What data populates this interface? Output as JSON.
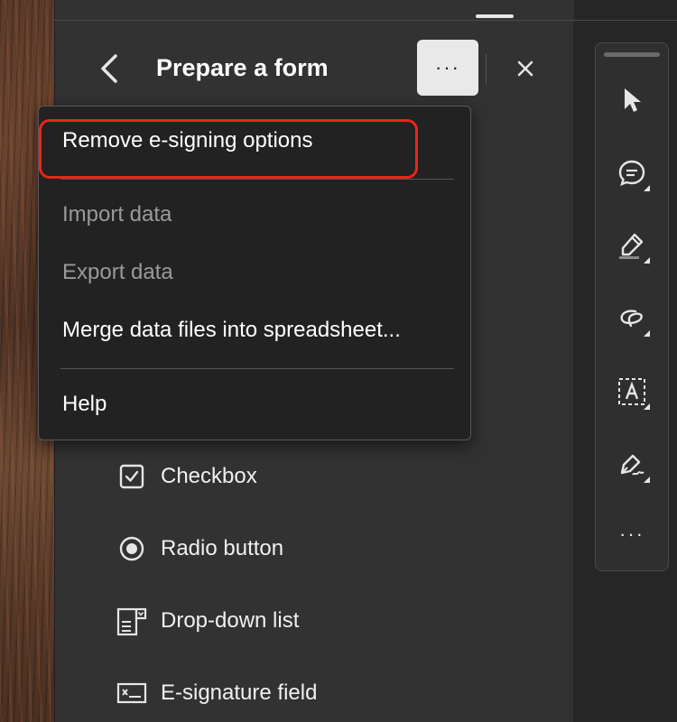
{
  "panel": {
    "title": "Prepare a form",
    "back_icon": "chevron-left-icon",
    "more_icon": "more-horizontal-icon",
    "more_label": "···",
    "close_icon": "close-icon"
  },
  "menu": {
    "items": [
      {
        "label": "Remove e-signing options",
        "enabled": true,
        "highlighted": true
      },
      {
        "label": "Import data",
        "enabled": false
      },
      {
        "label": "Export data",
        "enabled": false
      },
      {
        "label": "Merge data files into spreadsheet...",
        "enabled": true
      },
      {
        "label": "Help",
        "enabled": true
      }
    ],
    "highlight_color": "#e8261b"
  },
  "fields": [
    {
      "label": "Checkbox",
      "icon": "checkbox-icon"
    },
    {
      "label": "Radio button",
      "icon": "radio-button-icon"
    },
    {
      "label": "Drop-down list",
      "icon": "dropdown-list-icon"
    },
    {
      "label": "E-signature field",
      "icon": "e-signature-field-icon"
    }
  ],
  "toolbar": {
    "tools": [
      {
        "name": "select-tool",
        "icon": "cursor-arrow-icon"
      },
      {
        "name": "comment-tool",
        "icon": "comment-icon"
      },
      {
        "name": "highlight-tool",
        "icon": "highlighter-icon"
      },
      {
        "name": "draw-tool",
        "icon": "freehand-draw-icon"
      },
      {
        "name": "text-tool",
        "icon": "text-box-icon"
      },
      {
        "name": "sign-tool",
        "icon": "pen-sign-icon"
      },
      {
        "name": "more-tools",
        "icon": "more-horizontal-icon",
        "label": "···"
      }
    ]
  },
  "colors": {
    "panel_bg": "#323232",
    "menu_bg": "#222222",
    "text": "#ffffff",
    "disabled_text": "#9a9a9a"
  }
}
